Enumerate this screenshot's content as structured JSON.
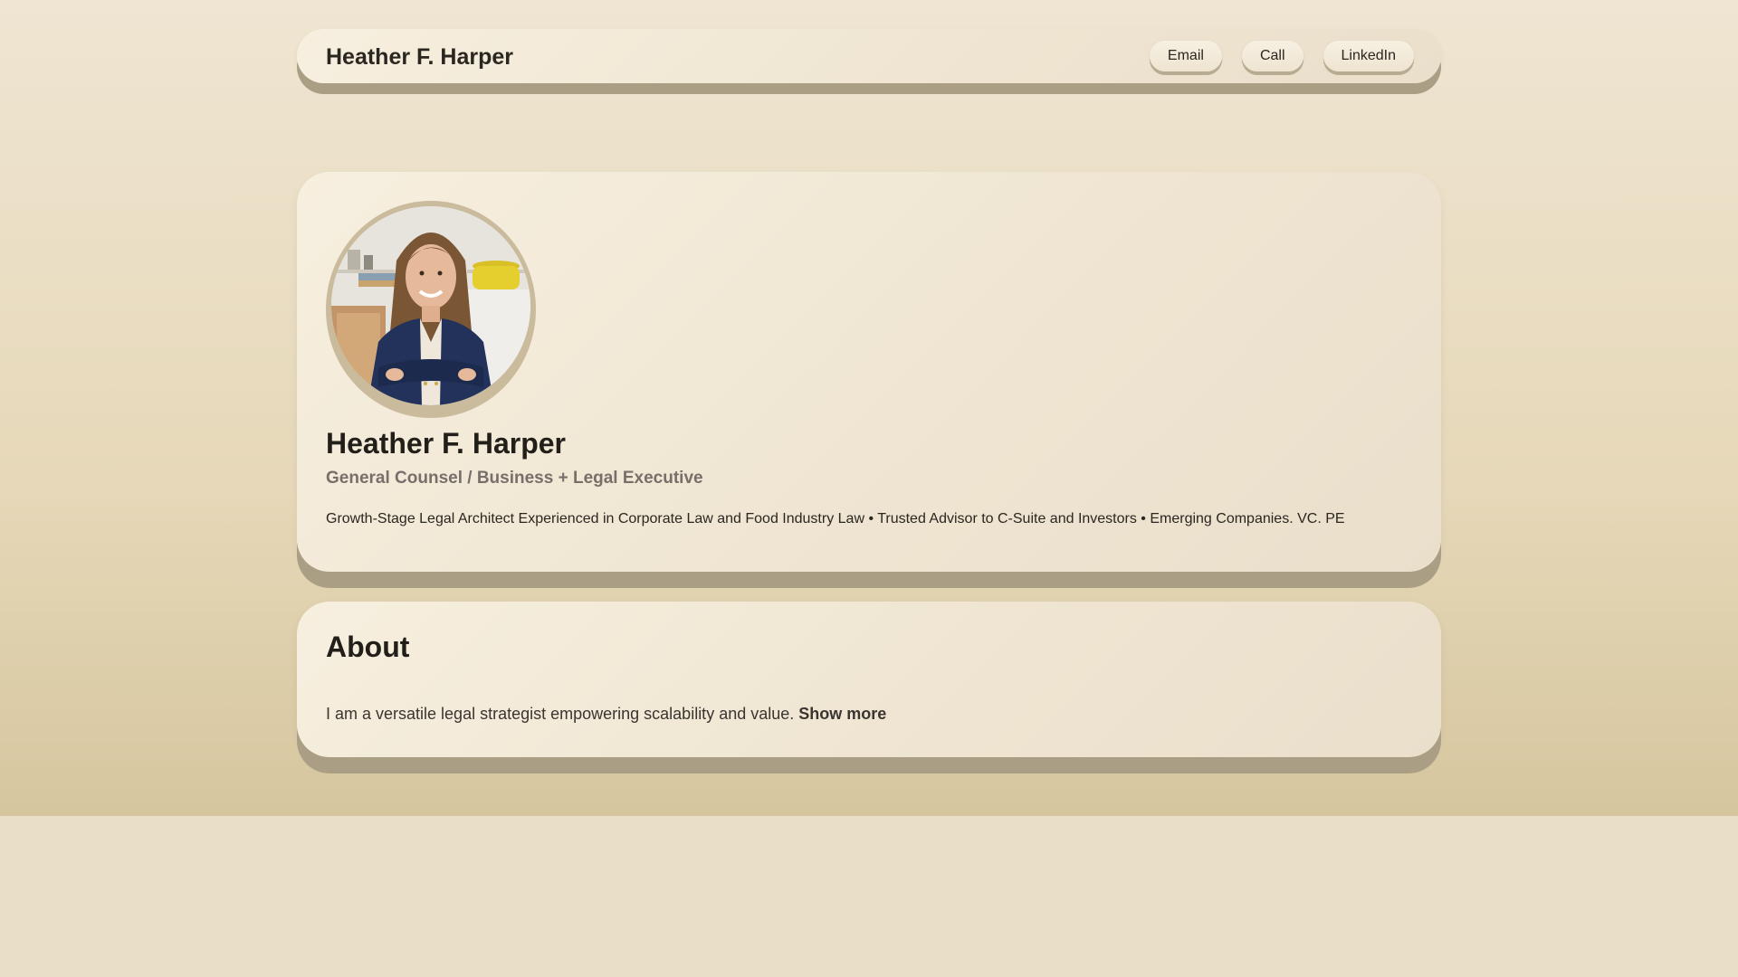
{
  "nav": {
    "title": "Heather F. Harper",
    "buttons": [
      {
        "label": "Email"
      },
      {
        "label": "Call"
      },
      {
        "label": "LinkedIn"
      }
    ]
  },
  "profile": {
    "name": "Heather F. Harper",
    "title": "General Counsel / Business + Legal Executive",
    "tagline": "Growth-Stage Legal Architect Experienced in Corporate Law and Food Industry Law • Trusted Advisor to C-Suite and Investors • Emerging Companies. VC. PE"
  },
  "about": {
    "heading": "About",
    "text": "I am a versatile legal strategist empowering scalability and value.",
    "show_more": "Show more"
  },
  "colors": {
    "background": "#e9dec7",
    "card": "#f3ead9",
    "card_shadow": "#aa9f85",
    "text": "#221e19",
    "muted": "#77706a"
  }
}
